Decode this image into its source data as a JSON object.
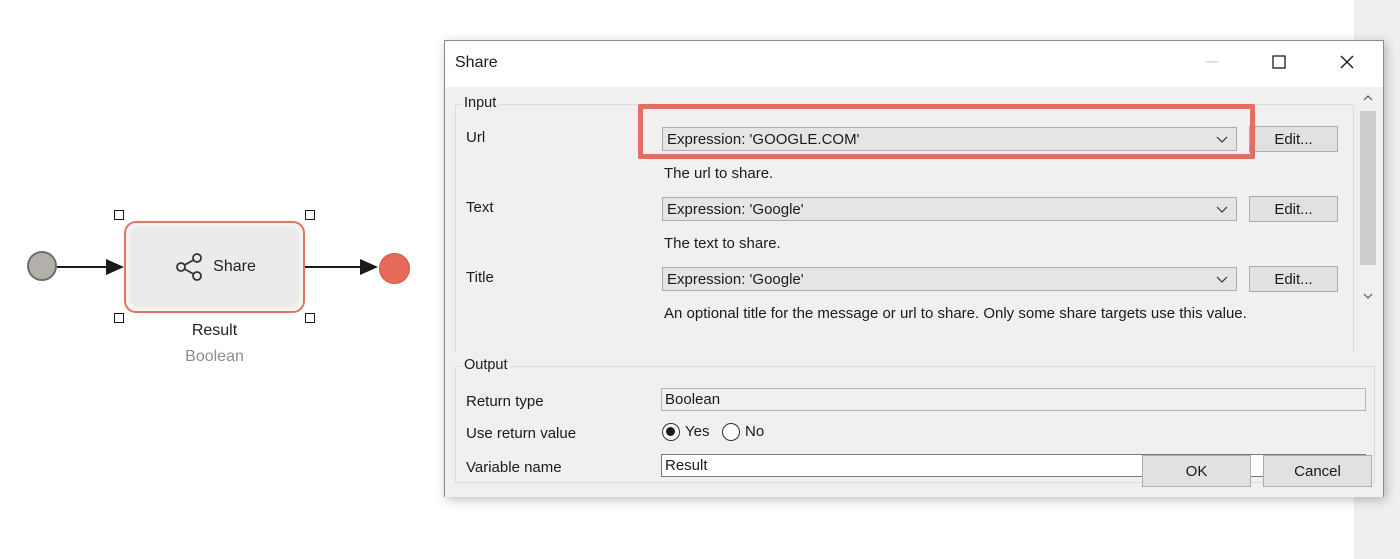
{
  "microflow": {
    "activity_label": "Share",
    "result_name": "Result",
    "result_type": "Boolean",
    "icons": {
      "activity": "share-icon"
    }
  },
  "dialog": {
    "title": "Share",
    "window_buttons": [
      "minimize-icon",
      "maximize-icon",
      "close-icon"
    ],
    "input": {
      "group_title": "Input",
      "fields": [
        {
          "label": "Url",
          "value": "Expression: 'GOOGLE.COM'",
          "edit_label": "Edit...",
          "hint": "The url to share."
        },
        {
          "label": "Text",
          "value": "Expression: 'Google'",
          "edit_label": "Edit...",
          "hint": "The text to share."
        },
        {
          "label": "Title",
          "value": "Expression: 'Google'",
          "edit_label": "Edit...",
          "hint": "An optional title for the message or url to share. Only some share targets use this value."
        }
      ]
    },
    "output": {
      "group_title": "Output",
      "return_type_label": "Return type",
      "return_type_value": "Boolean",
      "use_return_label": "Use return value",
      "yes_label": "Yes",
      "no_label": "No",
      "use_return_selected": "Yes",
      "variable_label": "Variable name",
      "variable_value": "Result"
    },
    "ok_label": "OK",
    "cancel_label": "Cancel",
    "highlight_color": "#e0705f"
  }
}
